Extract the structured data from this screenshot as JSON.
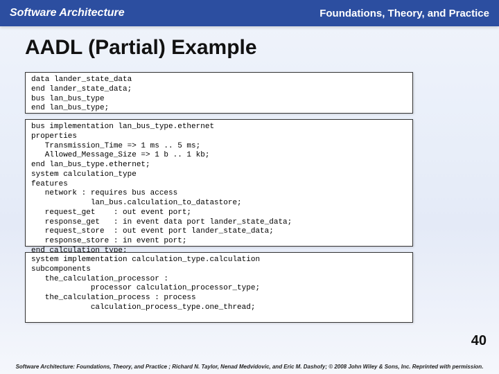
{
  "header": {
    "left": "Software Architecture",
    "right": "Foundations, Theory, and Practice"
  },
  "title": "AADL (Partial) Example",
  "code": {
    "block1": "data lander_state_data\nend lander_state_data;\nbus lan_bus_type\nend lan_bus_type;",
    "block2": "bus implementation lan_bus_type.ethernet\nproperties\n   Transmission_Time => 1 ms .. 5 ms;\n   Allowed_Message_Size => 1 b .. 1 kb;\nend lan_bus_type.ethernet;\nsystem calculation_type\nfeatures\n   network : requires bus access\n             lan_bus.calculation_to_datastore;\n   request_get    : out event port;\n   response_get   : in event data port lander_state_data;\n   request_store  : out event port lander_state_data;\n   response_store : in event port;\nend calculation_type;",
    "block3": "system implementation calculation_type.calculation\nsubcomponents\n   the_calculation_processor :\n             processor calculation_processor_type;\n   the_calculation_process : process\n             calculation_process_type.one_thread;"
  },
  "page_number": "40",
  "footer": "Software Architecture: Foundations, Theory, and Practice ; Richard N. Taylor, Nenad Medvidovic, and Eric M. Dashofy; © 2008 John Wiley & Sons, Inc. Reprinted with permission."
}
